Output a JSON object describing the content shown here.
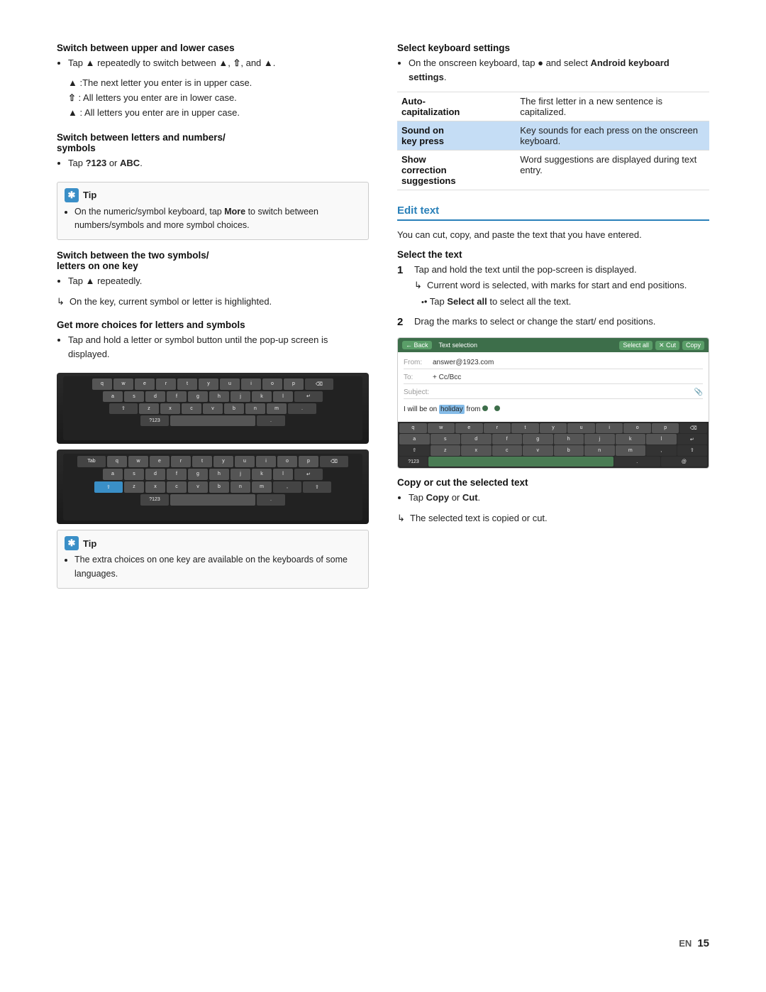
{
  "page": {
    "number": "15",
    "lang": "EN"
  },
  "left_col": {
    "sections": [
      {
        "id": "switch-upper-lower",
        "heading": "Switch between upper and lower cases",
        "bullets": [
          "Tap ▲ repeatedly to switch between ▲, ⇧, and ▲."
        ],
        "sub_items": [
          "▲ : The next letter you enter is in upper case.",
          "⇧ : All letters you enter are in lower case.",
          "▲ : All letters you enter are in upper case."
        ]
      },
      {
        "id": "switch-numbers-symbols",
        "heading": "Switch between letters and numbers/symbols",
        "bullets": [
          "Tap ?123 or ABC."
        ]
      },
      {
        "id": "tip1",
        "tip_text": "On the numeric/symbol keyboard, tap More to switch between numbers/symbols and more symbol choices."
      },
      {
        "id": "switch-two-symbols",
        "heading": "Switch between the two symbols/letters on one key",
        "bullets": [
          "Tap ▲ repeatedly."
        ],
        "indent_items": [
          "On the key, current symbol or letter is highlighted."
        ]
      },
      {
        "id": "more-choices",
        "heading": "Get more choices for letters and symbols",
        "bullets": [
          "Tap and hold a letter or symbol button until the pop-up screen is displayed."
        ]
      },
      {
        "id": "tip2",
        "tip_text": "The extra choices on one key are available on the keyboards of some languages."
      }
    ]
  },
  "right_col": {
    "select_keyboard_settings": {
      "heading": "Select keyboard settings",
      "intro": "On the onscreen keyboard, tap ● and select Android keyboard settings.",
      "table": [
        {
          "label": "Auto-capitalization",
          "description": "The first letter in a new sentence is capitalized.",
          "highlighted": false
        },
        {
          "label": "Sound on key press",
          "description": "Key sounds for each press on the onscreen keyboard.",
          "highlighted": true
        },
        {
          "label": "Show correction suggestions",
          "description": "Word suggestions are displayed during text entry.",
          "highlighted": false
        }
      ]
    },
    "edit_text": {
      "heading": "Edit text",
      "intro": "You can cut, copy, and paste the text that you have entered.",
      "select_text": {
        "heading": "Select the text",
        "steps": [
          {
            "num": "1",
            "text": "Tap and hold the text until the pop-screen is displayed.",
            "sub": [
              "Current word is selected, with marks for start and end positions.",
              "Tap Select all to select all the text."
            ]
          },
          {
            "num": "2",
            "text": "Drag the marks to select or change the start/end positions."
          }
        ]
      },
      "copy_cut": {
        "heading": "Copy or cut the selected text",
        "bullets": [
          "Tap Copy or Cut."
        ],
        "indent": "The selected text is copied or cut."
      }
    }
  },
  "keyboard_rows": {
    "row1": [
      "q",
      "w",
      "e",
      "r",
      "t",
      "y",
      "u",
      "i",
      "o",
      "p"
    ],
    "row2": [
      "a",
      "s",
      "d",
      "f",
      "g",
      "h",
      "j",
      "k",
      "l"
    ],
    "row3": [
      "z",
      "x",
      "c",
      "v",
      "b",
      "n",
      "m"
    ],
    "row4": [
      "?123",
      "",
      "",
      "",
      "",
      "",
      "",
      "",
      ""
    ]
  },
  "labels": {
    "tip": "Tip",
    "en": "EN",
    "page_num": "15",
    "copy_bold": "Copy",
    "cut_bold": "Cut",
    "select_all_bold": "Select all",
    "more_bold": "More",
    "android_keyboard_settings_bold": "Android keyboard settings"
  }
}
